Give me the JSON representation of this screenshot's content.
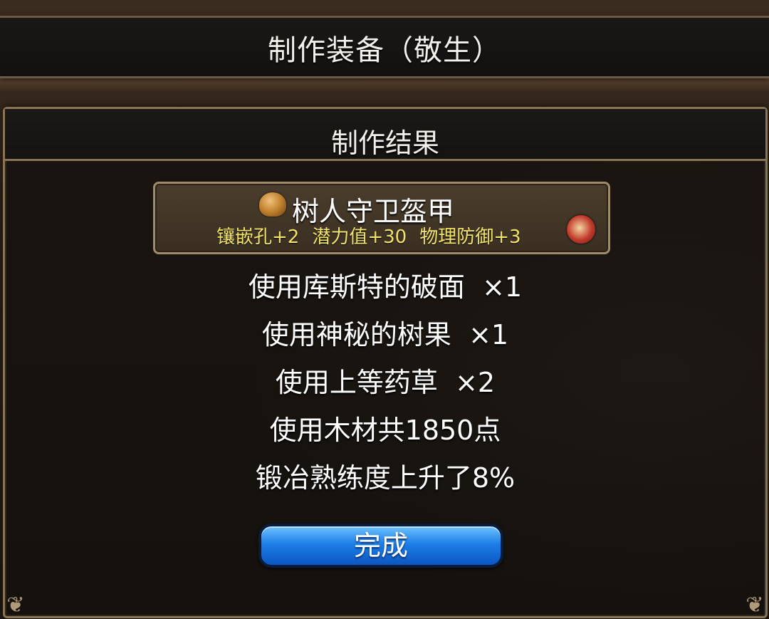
{
  "window": {
    "title": "制作装备（敬生）"
  },
  "dialog": {
    "title": "制作结果",
    "item": {
      "icon": "armor-icon",
      "name": "树人守卫盔甲",
      "stats": [
        "镶嵌孔+2",
        "潜力值+30",
        "物理防御+3"
      ],
      "badge_icon": "forge-hammer-icon"
    },
    "lines": [
      "使用库斯特的破面  ×1",
      "使用神秘的树果  ×1",
      "使用上等药草  ×2",
      "使用木材共1850点",
      "锻冶熟练度上升了8%"
    ],
    "done_label": "完成"
  },
  "colors": {
    "stat_yellow": "#f2e36a",
    "button_blue": "#1e7fe6",
    "border_gold": "#8a7456"
  }
}
